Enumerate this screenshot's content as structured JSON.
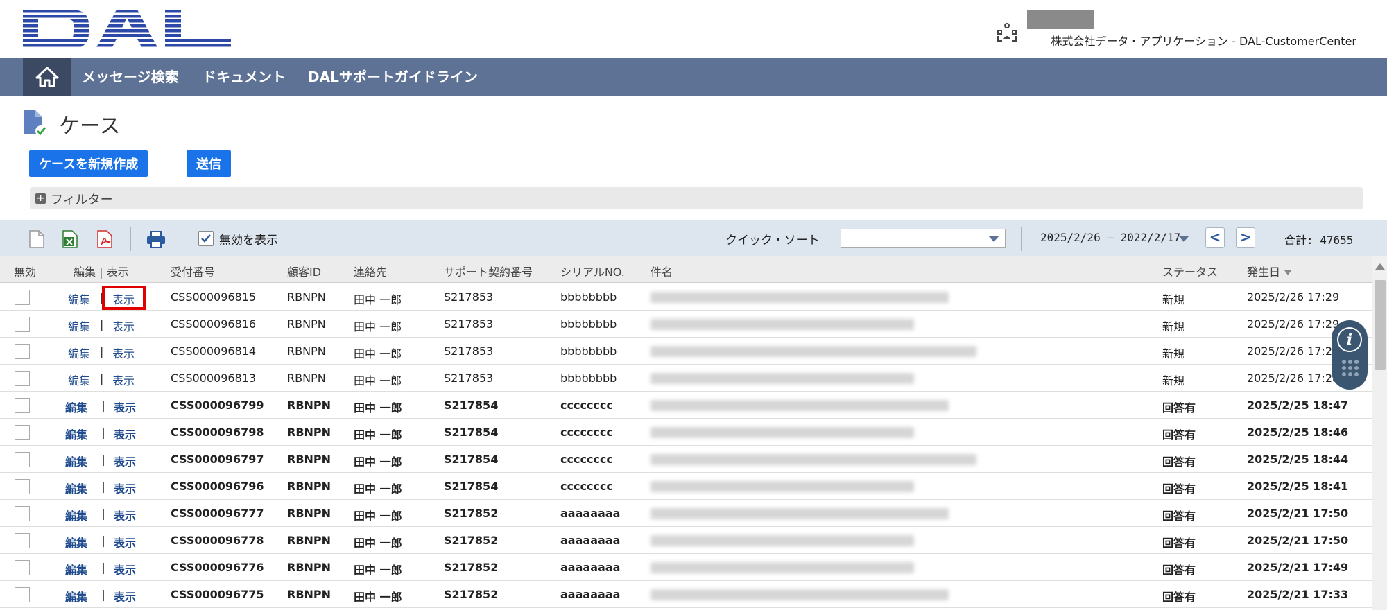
{
  "header": {
    "logo_alt": "DAL",
    "company": "株式会社データ・アプリケーション - DAL-CustomerCenter"
  },
  "nav": {
    "items": [
      "メッセージ検索",
      "ドキュメント",
      "DALサポートガイドライン"
    ]
  },
  "page": {
    "title": "ケース"
  },
  "buttons": {
    "new_case": "ケースを新規作成",
    "send": "送信"
  },
  "filter": {
    "label": "フィルター"
  },
  "toolbar": {
    "show_invalid_label": "無効を表示",
    "show_invalid_checked": true,
    "quick_sort_label": "クイック・ソート",
    "quick_sort_value": "",
    "date_range": "2025/2/26 – 2022/2/17",
    "prev": "<",
    "next": ">",
    "total": "合計: 47655"
  },
  "table": {
    "headers": {
      "invalid": "無効",
      "edit_view": "編集 | 表示",
      "receipt_no": "受付番号",
      "customer_id": "顧客ID",
      "contact": "連絡先",
      "contract_no": "サポート契約番号",
      "serial": "シリアルNO.",
      "subject": "件名",
      "status": "ステータス",
      "date": "発生日"
    },
    "edit_label": "編集",
    "view_label": "表示",
    "pipe": "|",
    "rows": [
      {
        "receipt": "CSS000096815",
        "customer": "RBNPN",
        "contact": "田中 一郎",
        "contract": "S217853",
        "serial": "bbbbbbbb",
        "status": "新規",
        "date": "2025/2/26 17:29"
      },
      {
        "receipt": "CSS000096816",
        "customer": "RBNPN",
        "contact": "田中 一郎",
        "contract": "S217853",
        "serial": "bbbbbbbb",
        "status": "新規",
        "date": "2025/2/26 17:29"
      },
      {
        "receipt": "CSS000096814",
        "customer": "RBNPN",
        "contact": "田中 一郎",
        "contract": "S217853",
        "serial": "bbbbbbbb",
        "status": "新規",
        "date": "2025/2/26 17:28"
      },
      {
        "receipt": "CSS000096813",
        "customer": "RBNPN",
        "contact": "田中 一郎",
        "contract": "S217853",
        "serial": "bbbbbbbb",
        "status": "新規",
        "date": "2025/2/26 17:28"
      },
      {
        "receipt": "CSS000096799",
        "customer": "RBNPN",
        "contact": "田中 一郎",
        "contract": "S217854",
        "serial": "cccccccc",
        "status": "回答有",
        "date": "2025/2/25 18:47"
      },
      {
        "receipt": "CSS000096798",
        "customer": "RBNPN",
        "contact": "田中 一郎",
        "contract": "S217854",
        "serial": "cccccccc",
        "status": "回答有",
        "date": "2025/2/25 18:46"
      },
      {
        "receipt": "CSS000096797",
        "customer": "RBNPN",
        "contact": "田中 一郎",
        "contract": "S217854",
        "serial": "cccccccc",
        "status": "回答有",
        "date": "2025/2/25 18:44"
      },
      {
        "receipt": "CSS000096796",
        "customer": "RBNPN",
        "contact": "田中 一郎",
        "contract": "S217854",
        "serial": "cccccccc",
        "status": "回答有",
        "date": "2025/2/25 18:41"
      },
      {
        "receipt": "CSS000096777",
        "customer": "RBNPN",
        "contact": "田中 一郎",
        "contract": "S217852",
        "serial": "aaaaaaaa",
        "status": "回答有",
        "date": "2025/2/21 17:50"
      },
      {
        "receipt": "CSS000096778",
        "customer": "RBNPN",
        "contact": "田中 一郎",
        "contract": "S217852",
        "serial": "aaaaaaaa",
        "status": "回答有",
        "date": "2025/2/21 17:50"
      },
      {
        "receipt": "CSS000096776",
        "customer": "RBNPN",
        "contact": "田中 一郎",
        "contract": "S217852",
        "serial": "aaaaaaaa",
        "status": "回答有",
        "date": "2025/2/21 17:49"
      },
      {
        "receipt": "CSS000096775",
        "customer": "RBNPN",
        "contact": "田中 一郎",
        "contract": "S217852",
        "serial": "aaaaaaaa",
        "status": "回答有",
        "date": "2025/2/21 17:33"
      }
    ]
  },
  "colors": {
    "nav_bg": "#5e7295",
    "nav_home_bg": "#3b4a62",
    "primary_button": "#1a73e8",
    "link": "#1f4b8e",
    "highlight": "#e00000"
  }
}
